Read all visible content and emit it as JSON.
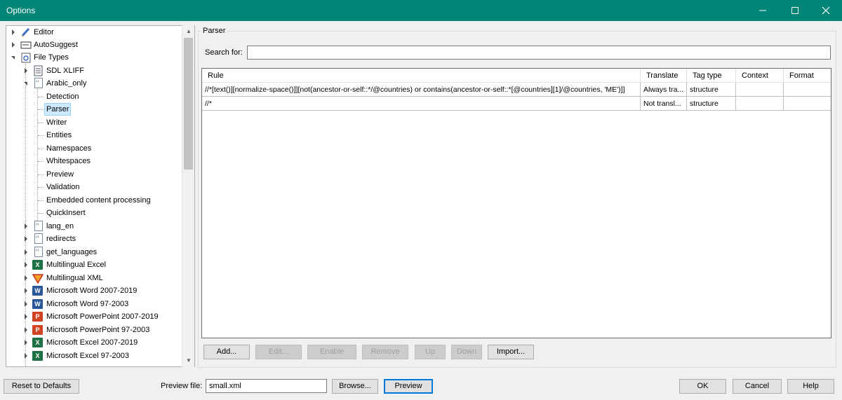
{
  "window": {
    "title": "Options"
  },
  "tree": {
    "items": [
      {
        "label": "Editor",
        "icon": "pencil-icon"
      },
      {
        "label": "AutoSuggest",
        "icon": "autosuggest-icon"
      },
      {
        "label": "File Types",
        "icon": "filetypes-icon"
      },
      {
        "label": "SDL XLIFF",
        "icon": "sdlxliff-icon"
      },
      {
        "label": "Arabic_only",
        "icon": "xml-file-icon"
      },
      {
        "label": "Detection"
      },
      {
        "label": "Parser"
      },
      {
        "label": "Writer"
      },
      {
        "label": "Entities"
      },
      {
        "label": "Namespaces"
      },
      {
        "label": "Whitespaces"
      },
      {
        "label": "Preview"
      },
      {
        "label": "Validation"
      },
      {
        "label": "Embedded content processing"
      },
      {
        "label": "QuickInsert"
      },
      {
        "label": "lang_en",
        "icon": "xml-file-icon"
      },
      {
        "label": "redirects",
        "icon": "xml-file-icon"
      },
      {
        "label": "get_languages",
        "icon": "xml-file-icon"
      },
      {
        "label": "Multilingual Excel",
        "icon": "excel-icon"
      },
      {
        "label": "Multilingual XML",
        "icon": "multilingual-xml-icon"
      },
      {
        "label": "Microsoft Word 2007-2019",
        "icon": "word-icon"
      },
      {
        "label": "Microsoft Word 97-2003",
        "icon": "word-icon"
      },
      {
        "label": "Microsoft PowerPoint 2007-2019",
        "icon": "powerpoint-icon"
      },
      {
        "label": "Microsoft PowerPoint 97-2003",
        "icon": "powerpoint-icon"
      },
      {
        "label": "Microsoft Excel 2007-2019",
        "icon": "excel-icon"
      },
      {
        "label": "Microsoft Excel 97-2003",
        "icon": "excel-icon"
      }
    ]
  },
  "parser": {
    "group_title": "Parser",
    "search_label": "Search for:",
    "search_value": "",
    "columns": [
      "Rule",
      "Translate",
      "Tag type",
      "Context",
      "Format"
    ],
    "rows": [
      {
        "rule": "//*[text()][normalize-space()]][not(ancestor-or-self::*/@countries) or contains(ancestor-or-self::*[@countries][1]/@countries, 'ME')]]",
        "translate": "Always tra...",
        "tag_type": "structure",
        "context": "",
        "format": ""
      },
      {
        "rule": "//*",
        "translate": "Not transl...",
        "tag_type": "structure",
        "context": "",
        "format": ""
      }
    ],
    "buttons": {
      "add": "Add...",
      "edit": "Edit...",
      "enable": "Enable",
      "remove": "Remove",
      "up": "Up",
      "down": "Down",
      "import": "Import..."
    }
  },
  "footer": {
    "reset": "Reset to Defaults",
    "preview_label": "Preview file:",
    "preview_value": "small.xml",
    "browse": "Browse...",
    "preview": "Preview",
    "ok": "OK",
    "cancel": "Cancel",
    "help": "Help"
  },
  "colors": {
    "titlebar": "#008577",
    "selection": "#cce8ff"
  }
}
